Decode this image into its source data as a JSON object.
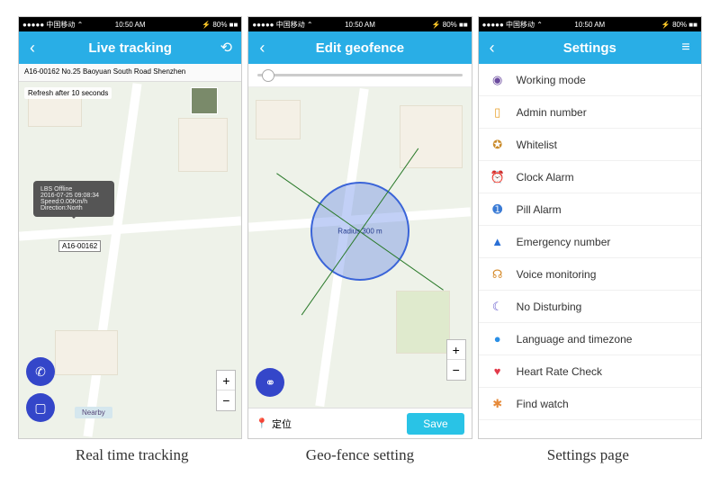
{
  "statusbar": {
    "carrier": "●●●●● 中国移动 ⌃",
    "time": "10:50 AM",
    "right": "⚡ 80% ■■"
  },
  "screen1": {
    "title": "Live tracking",
    "address": "A16-00162 No.25 Baoyuan South Road Shenzhen",
    "refresh": "Refresh after 10 seconds",
    "tooltip": {
      "l1": "LBS Offline",
      "l2": "2016-07-25 09:08:34",
      "l3": "Speed:0.00Km/h",
      "l4": "Direction:North"
    },
    "pin": "A16-00162",
    "nearby": "Nearby"
  },
  "screen2": {
    "title": "Edit geofence",
    "radius": "Radius 300 m",
    "locate": "定位",
    "save": "Save"
  },
  "screen3": {
    "title": "Settings",
    "items": [
      {
        "iconColor": "#6b4b9e",
        "glyph": "◉",
        "label": "Working mode"
      },
      {
        "iconColor": "#e8a02a",
        "glyph": "▯",
        "label": "Admin number"
      },
      {
        "iconColor": "#c98a2a",
        "glyph": "✪",
        "label": "Whitelist"
      },
      {
        "iconColor": "#2ac7d6",
        "glyph": "⏰",
        "label": "Clock Alarm"
      },
      {
        "iconColor": "#3a7bd5",
        "glyph": "➊",
        "label": "Pill Alarm"
      },
      {
        "iconColor": "#2a6fd6",
        "glyph": "▲",
        "label": "Emergency number"
      },
      {
        "iconColor": "#d68a2a",
        "glyph": "☊",
        "label": "Voice monitoring"
      },
      {
        "iconColor": "#5a4fc9",
        "glyph": "☾",
        "label": "No Disturbing"
      },
      {
        "iconColor": "#2a8fe6",
        "glyph": "●",
        "label": "Language and timezone"
      },
      {
        "iconColor": "#e23a4a",
        "glyph": "♥",
        "label": "Heart Rate Check"
      },
      {
        "iconColor": "#e68a3a",
        "glyph": "✱",
        "label": "Find watch"
      }
    ]
  },
  "captions": {
    "c1": "Real time tracking",
    "c2": "Geo-fence setting",
    "c3": "Settings page"
  }
}
